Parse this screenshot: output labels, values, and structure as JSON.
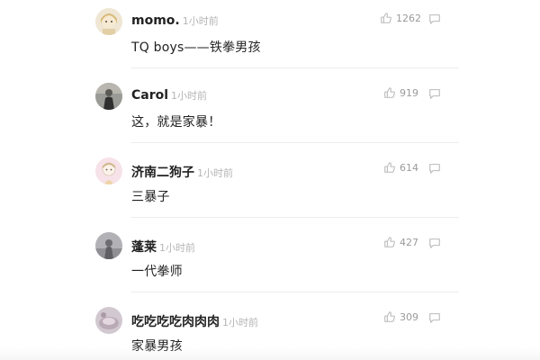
{
  "comments": [
    {
      "name": "momo.",
      "time": "1小时前",
      "text": "TQ boys——铁拳男孩",
      "likes": "1262",
      "avatar_icon": "cartoon-girl-avatar",
      "avatar_color": "#e9dcc4"
    },
    {
      "name": "Carol",
      "time": "1小时前",
      "text": "这，就是家暴！",
      "likes": "919",
      "avatar_icon": "person-photo-avatar",
      "avatar_color": "#8c8c88"
    },
    {
      "name": "济南二狗子",
      "time": "1小时前",
      "text": "三暴子",
      "likes": "614",
      "avatar_icon": "cartoon-figure-avatar",
      "avatar_color": "#f3d9e2"
    },
    {
      "name": "蓬莱",
      "time": "1小时前",
      "text": "一代拳师",
      "likes": "427",
      "avatar_icon": "silhouette-photo-avatar",
      "avatar_color": "#a8a8ac"
    },
    {
      "name": "吃吃吃吃肉肉肉",
      "time": "1小时前",
      "text": "家暴男孩",
      "likes": "309",
      "avatar_icon": "food-photo-avatar",
      "avatar_color": "#c9bfc8"
    }
  ],
  "icons": {
    "like": "thumbs-up-icon",
    "reply": "comment-bubble-icon"
  }
}
